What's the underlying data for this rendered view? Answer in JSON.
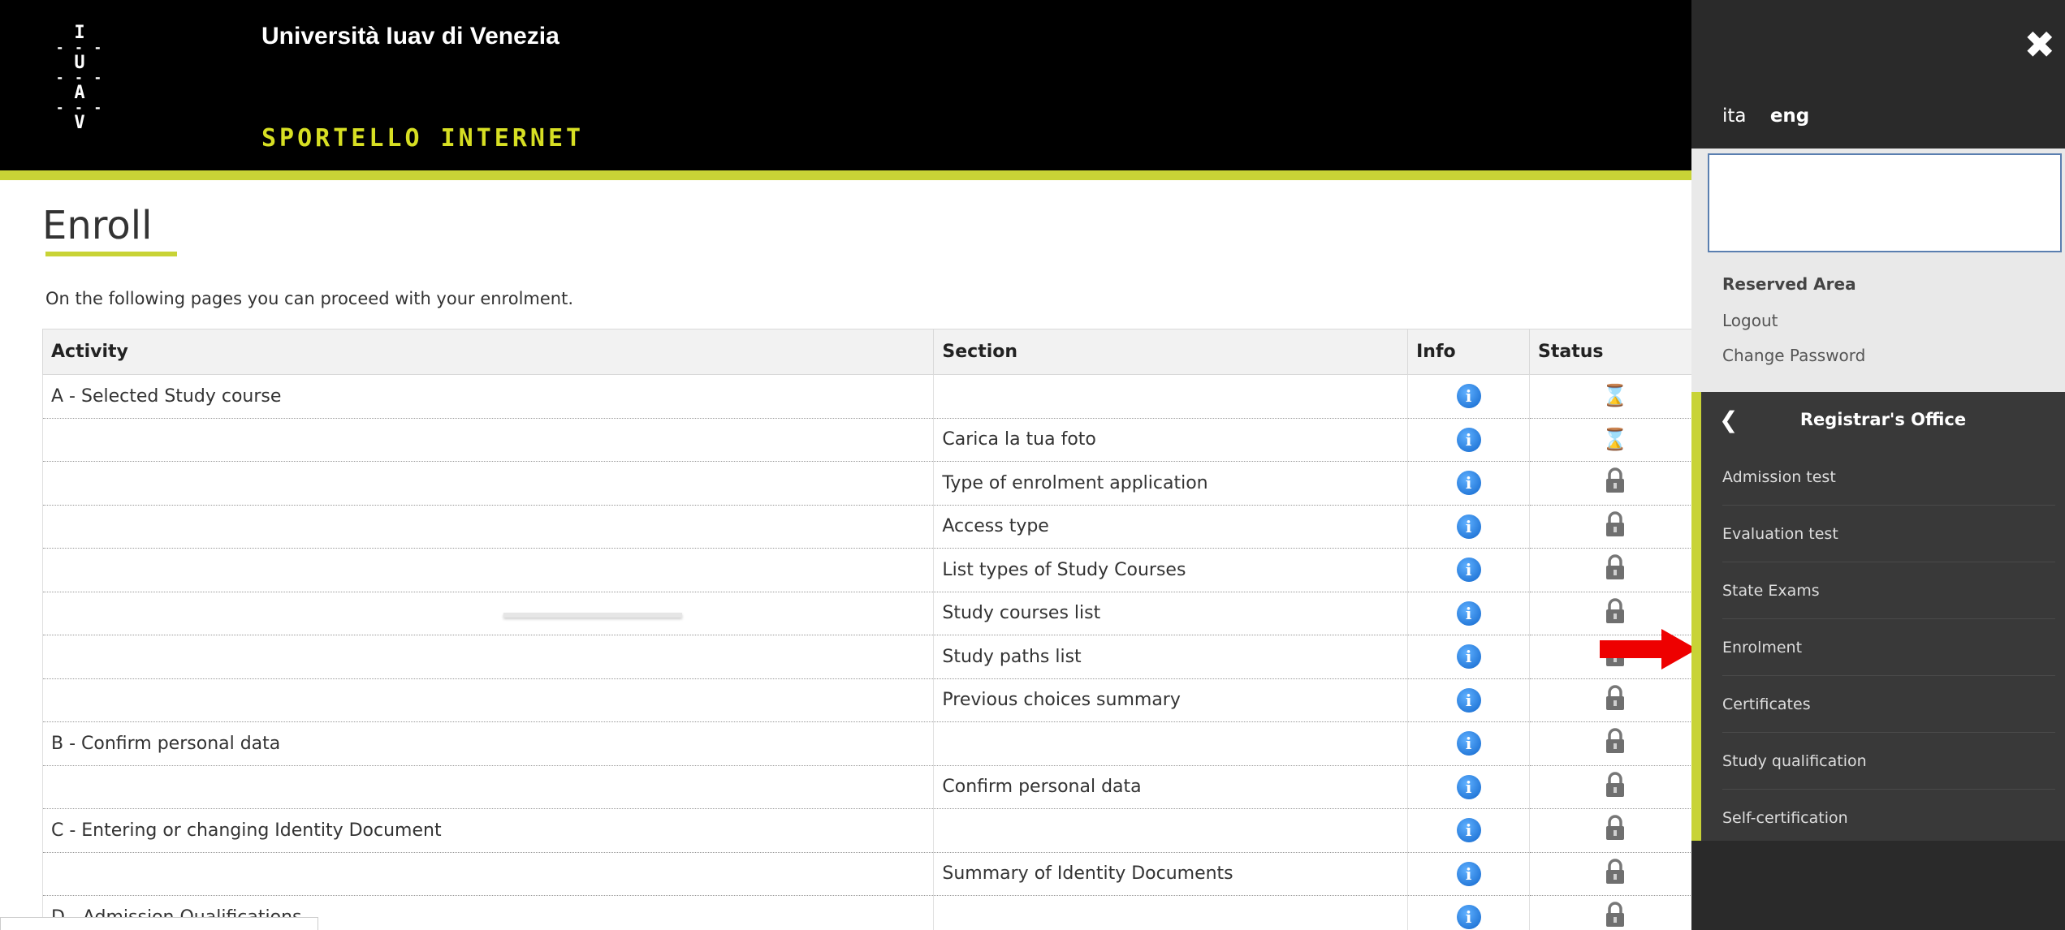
{
  "header": {
    "logo_letters": [
      "I",
      "U",
      "A",
      "V"
    ],
    "university": "Università Iuav di Venezia",
    "portal": "SPORTELLO INTERNET"
  },
  "main": {
    "title": "Enroll",
    "intro": "On the following pages you can proceed with your enrolment.",
    "table": {
      "headers": [
        "Activity",
        "Section",
        "Info",
        "Status"
      ],
      "rows": [
        {
          "activity": "A - Selected Study course",
          "section": "",
          "status": "hourglass"
        },
        {
          "activity": "",
          "section": "Carica la tua foto",
          "status": "hourglass"
        },
        {
          "activity": "",
          "section": "Type of enrolment application",
          "status": "lock"
        },
        {
          "activity": "",
          "section": "Access type",
          "status": "lock"
        },
        {
          "activity": "",
          "section": "List types of Study Courses",
          "status": "lock"
        },
        {
          "activity": "",
          "section": "Study courses list",
          "status": "lock"
        },
        {
          "activity": "",
          "section": "Study paths list",
          "status": "lock"
        },
        {
          "activity": "",
          "section": "Previous choices summary",
          "status": "lock"
        },
        {
          "activity": "B - Confirm personal data",
          "section": "",
          "status": "lock"
        },
        {
          "activity": "",
          "section": "Confirm personal data",
          "status": "lock"
        },
        {
          "activity": "C - Entering or changing Identity Document",
          "section": "",
          "status": "lock"
        },
        {
          "activity": "",
          "section": "Summary of Identity Documents",
          "status": "lock"
        },
        {
          "activity": "D - Admission Qualifications",
          "section": "",
          "status": "lock"
        }
      ],
      "info_icon": "info-icon"
    }
  },
  "panel": {
    "close_icon": "close-icon",
    "lang_ita": "ita",
    "lang_eng": "eng",
    "reserved_area": "Reserved Area",
    "logout": "Logout",
    "change_password": "Change Password",
    "office_title": "Registrar's Office",
    "menu": [
      "Admission test",
      "Evaluation test",
      "State Exams",
      "Enrolment",
      "Certificates",
      "Study qualification",
      "Self-certification"
    ]
  },
  "colors": {
    "accent": "#c8d336",
    "header_bg": "#000000",
    "panel_bg": "#393939",
    "arrow": "#ee0000"
  }
}
